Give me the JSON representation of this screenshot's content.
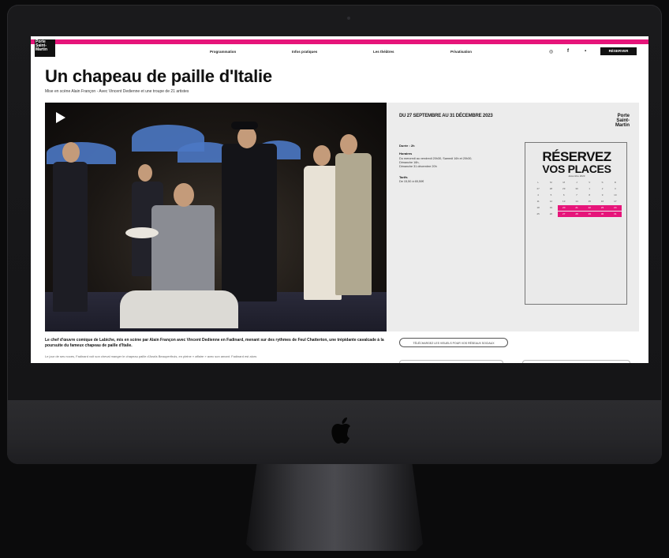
{
  "site": {
    "logo_lines": [
      "Porte",
      "Saint-",
      "Martin"
    ],
    "nav": [
      "Programmation",
      "Infos pratiques",
      "Les théâtres",
      "Privatisation"
    ],
    "social_icons": [
      "instagram-icon",
      "facebook-icon",
      "youtube-icon"
    ],
    "reserve_label": "RÉSERVER",
    "accent_color": "#e6157a"
  },
  "show": {
    "title": "Un chapeau de paille d'Italie",
    "subtitle": "Mise en scène Alain Françon - Avec Vincent Dedienne et une troupe de 21 artistes"
  },
  "info": {
    "dates": "DU 27 SEPTEMBRE AU 31 DÉCEMBRE 2023",
    "brand_lines": [
      "Porte",
      "Saint-",
      "Martin"
    ],
    "duree_label": "Durée : 2h",
    "horaires_title": "Horaires",
    "horaires_lines": [
      "Du mercredi au vendredi 20h30, Samedi 16h et 20h30,",
      "Dimanche 16h,",
      "Dimanche 31 décembre 20h"
    ],
    "tarifs_title": "Tarifs",
    "tarifs_value": "De 15,50 à 65,50€"
  },
  "calendar": {
    "title_line1": "RÉSERVEZ",
    "title_line2": "VOS PLACES",
    "month": "décembre 2023",
    "weekdays": [
      "L",
      "M",
      "M",
      "J",
      "V",
      "S",
      "D"
    ],
    "rows": [
      [
        "27",
        "28",
        "29",
        "30",
        "1",
        "2",
        "3"
      ],
      [
        "4",
        "5",
        "6",
        "7",
        "8",
        "9",
        "10"
      ],
      [
        "11",
        "12",
        "13",
        "14",
        "15",
        "16",
        "17"
      ],
      [
        "18",
        "19",
        "20",
        "21",
        "22",
        "23",
        "24"
      ],
      [
        "25",
        "26",
        "27",
        "28",
        "29",
        "30",
        "31"
      ]
    ],
    "highlighted": [
      [
        3,
        2
      ],
      [
        3,
        3
      ],
      [
        3,
        4
      ],
      [
        3,
        5
      ],
      [
        3,
        6
      ],
      [
        4,
        2
      ],
      [
        4,
        3
      ],
      [
        4,
        4
      ],
      [
        4,
        5
      ],
      [
        4,
        6
      ]
    ]
  },
  "body": {
    "lead": "Le chef d'œuvre comique de Labiche, mis en scène par Alain Françon avec Vincent Dedienne en Fadinard, menant sur des rythmes de Feul Chatterton, une trépidante cavalcade à la poursuite du fameux chapeau de paille d'Italie.",
    "para": "Le jour de ses noces, Fadinard voit son cheval manger le chapeau paille d'Anaïs Beauperthuis, en pleine « affaire » avec son amant. Fadinard est alors",
    "visuals_button": "TÉLÉCHARGEZ LES VISUELS POUR VOS RÉSEAUX SOCIAUX"
  }
}
